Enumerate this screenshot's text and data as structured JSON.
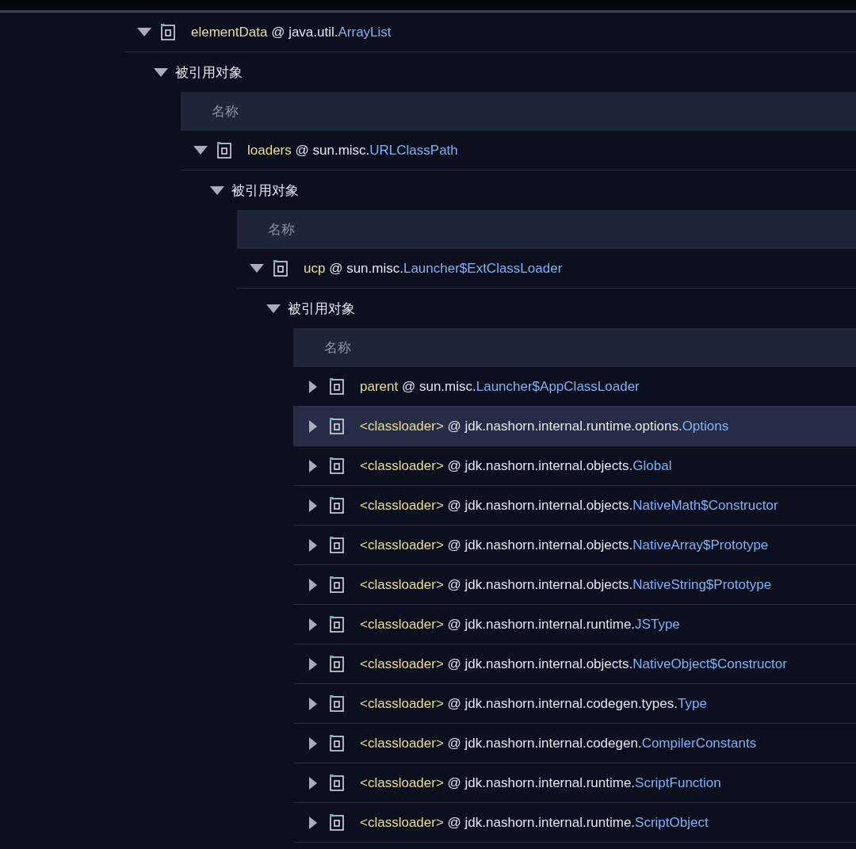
{
  "tree": [
    {
      "name": "elementData",
      "separator": "@",
      "package": "java.util.",
      "class": "ArrayList",
      "expanded": true,
      "selected": false,
      "referrers": {
        "label": "被引用对象",
        "expanded": true,
        "column": "名称",
        "children": [
          {
            "name": "loaders",
            "separator": "@",
            "package": "sun.misc.",
            "class": "URLClassPath",
            "expanded": true,
            "selected": false,
            "referrers": {
              "label": "被引用对象",
              "expanded": true,
              "column": "名称",
              "children": [
                {
                  "name": "ucp",
                  "separator": "@",
                  "package": "sun.misc.",
                  "class": "Launcher$ExtClassLoader",
                  "expanded": true,
                  "selected": false,
                  "referrers": {
                    "label": "被引用对象",
                    "expanded": true,
                    "column": "名称",
                    "children": [
                      {
                        "name": "parent",
                        "separator": "@",
                        "package": "sun.misc.",
                        "class": "Launcher$AppClassLoader",
                        "expanded": false,
                        "selected": false
                      },
                      {
                        "name": "<classloader>",
                        "separator": "@",
                        "package": "jdk.nashorn.internal.runtime.options.",
                        "class": "Options",
                        "expanded": false,
                        "selected": true
                      },
                      {
                        "name": "<classloader>",
                        "separator": "@",
                        "package": "jdk.nashorn.internal.objects.",
                        "class": "Global",
                        "expanded": false,
                        "selected": false
                      },
                      {
                        "name": "<classloader>",
                        "separator": "@",
                        "package": "jdk.nashorn.internal.objects.",
                        "class": "NativeMath$Constructor",
                        "expanded": false,
                        "selected": false
                      },
                      {
                        "name": "<classloader>",
                        "separator": "@",
                        "package": "jdk.nashorn.internal.objects.",
                        "class": "NativeArray$Prototype",
                        "expanded": false,
                        "selected": false
                      },
                      {
                        "name": "<classloader>",
                        "separator": "@",
                        "package": "jdk.nashorn.internal.objects.",
                        "class": "NativeString$Prototype",
                        "expanded": false,
                        "selected": false
                      },
                      {
                        "name": "<classloader>",
                        "separator": "@",
                        "package": "jdk.nashorn.internal.runtime.",
                        "class": "JSType",
                        "expanded": false,
                        "selected": false
                      },
                      {
                        "name": "<classloader>",
                        "separator": "@",
                        "package": "jdk.nashorn.internal.objects.",
                        "class": "NativeObject$Constructor",
                        "expanded": false,
                        "selected": false
                      },
                      {
                        "name": "<classloader>",
                        "separator": "@",
                        "package": "jdk.nashorn.internal.codegen.types.",
                        "class": "Type",
                        "expanded": false,
                        "selected": false
                      },
                      {
                        "name": "<classloader>",
                        "separator": "@",
                        "package": "jdk.nashorn.internal.codegen.",
                        "class": "CompilerConstants",
                        "expanded": false,
                        "selected": false
                      },
                      {
                        "name": "<classloader>",
                        "separator": "@",
                        "package": "jdk.nashorn.internal.runtime.",
                        "class": "ScriptFunction",
                        "expanded": false,
                        "selected": false
                      },
                      {
                        "name": "<classloader>",
                        "separator": "@",
                        "package": "jdk.nashorn.internal.runtime.",
                        "class": "ScriptObject",
                        "expanded": false,
                        "selected": false
                      }
                    ]
                  }
                }
              ]
            }
          }
        ]
      }
    }
  ]
}
